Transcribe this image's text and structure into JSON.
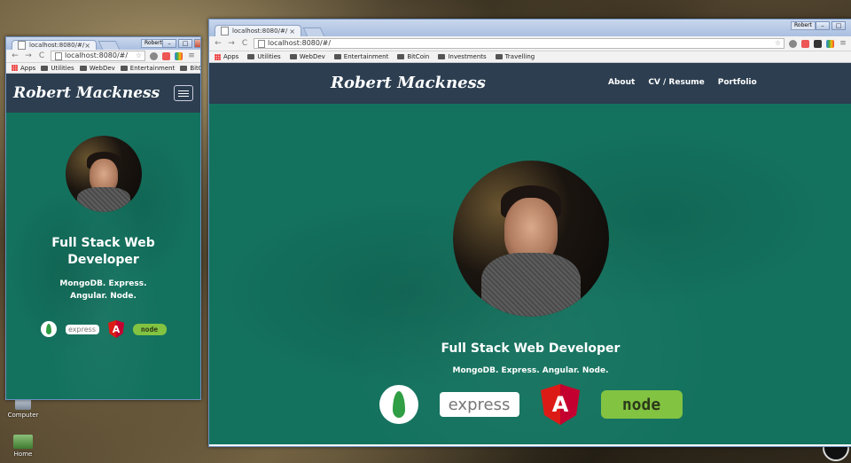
{
  "desktop": {
    "icons": [
      {
        "label": "Computer"
      },
      {
        "label": "Home"
      }
    ]
  },
  "small_window": {
    "tab_title": "localhost:8080/#/",
    "username": "Robert",
    "url": "localhost:8080/#/",
    "bookmarks": [
      "Apps",
      "Utilities",
      "WebDev",
      "Entertainment",
      "BitCoin"
    ],
    "brand": "Robert Mackness",
    "heading": "Full Stack Web Developer",
    "subheading": "MongoDB. Express. Angular. Node."
  },
  "large_window": {
    "tab_title": "localhost:8080/#/",
    "username": "Robert",
    "url": "localhost:8080/#/",
    "bookmarks": [
      "Apps",
      "Utilities",
      "WebDev",
      "Entertainment",
      "BitCoin",
      "Investments",
      "Travelling"
    ],
    "brand": "Robert Mackness",
    "menu": [
      "About",
      "CV / Resume",
      "Portfolio"
    ],
    "heading": "Full Stack Web Developer",
    "subheading": "MongoDB. Express. Angular. Node."
  },
  "logos": {
    "express_text": "express",
    "angular_letter": "A",
    "node_text": "node"
  },
  "colors": {
    "site_bg": "#13725e",
    "nav_bg": "#2c3e50",
    "angular_red": "#dd1b16",
    "node_green": "#82c341",
    "mongo_green": "#2f9e44"
  }
}
